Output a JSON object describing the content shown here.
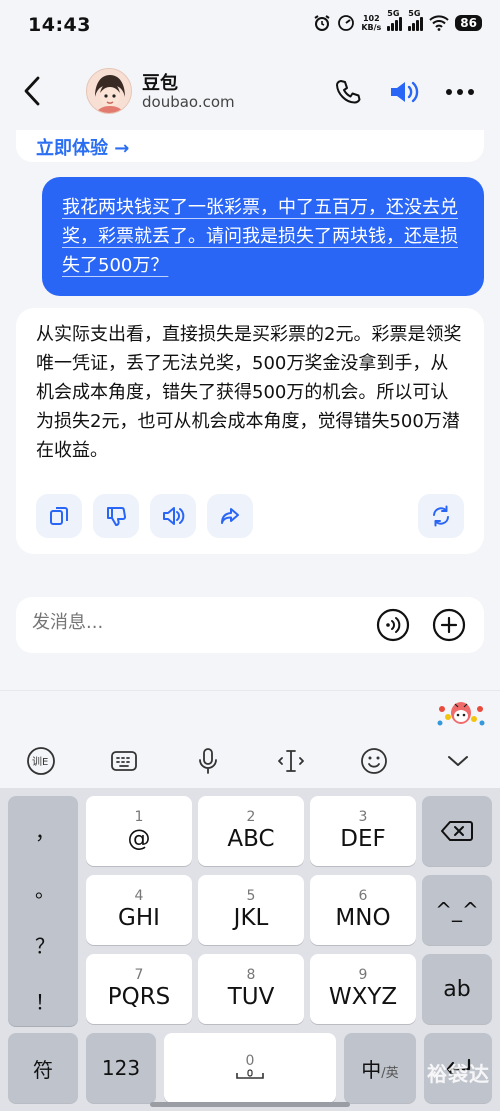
{
  "status_bar": {
    "time": "14:43",
    "net_speed_value": "102",
    "net_speed_unit": "KB/s",
    "sim1": "5G",
    "sim2": "5G",
    "battery": "86"
  },
  "header": {
    "title": "豆包",
    "subtitle": "doubao.com"
  },
  "chat": {
    "previous_link": "立即体验 →",
    "user_message": "我花两块钱买了一张彩票，中了五百万，还没去兑奖，彩票就丢了。请问我是损失了两块钱，还是损失了500万？",
    "ai_message": "从实际支出看，直接损失是买彩票的2元。彩票是领奖唯一凭证，丢了无法兑奖，500万奖金没拿到手，从机会成本角度，错失了获得500万的机会。所以可认为损失2元，也可从机会成本角度，觉得错失500万潜在收益。",
    "actions": [
      "copy-icon",
      "thumbs-down-icon",
      "speaker-icon",
      "share-icon",
      "regenerate-icon"
    ]
  },
  "composer": {
    "placeholder": "发消息..."
  },
  "keyboard": {
    "punctuation": [
      "，",
      "。",
      "？",
      "！"
    ],
    "keys": [
      {
        "num": "1",
        "letters": "@"
      },
      {
        "num": "2",
        "letters": "ABC"
      },
      {
        "num": "3",
        "letters": "DEF"
      },
      {
        "num": "4",
        "letters": "GHI"
      },
      {
        "num": "5",
        "letters": "JKL"
      },
      {
        "num": "6",
        "letters": "MNO"
      },
      {
        "num": "7",
        "letters": "PQRS"
      },
      {
        "num": "8",
        "letters": "TUV"
      },
      {
        "num": "9",
        "letters": "WXYZ"
      }
    ],
    "emoticon_key": "^_^",
    "ab_key": "ab",
    "symbol_key": "符",
    "numeric_key": "123",
    "space_num": "0",
    "lang_key_main": "中",
    "lang_key_sub": "/英",
    "watermark": "裕袋达"
  },
  "colors": {
    "accent": "#2a66f6",
    "background": "#f4f5f8",
    "keyboard_bg": "#dfe1e6"
  }
}
